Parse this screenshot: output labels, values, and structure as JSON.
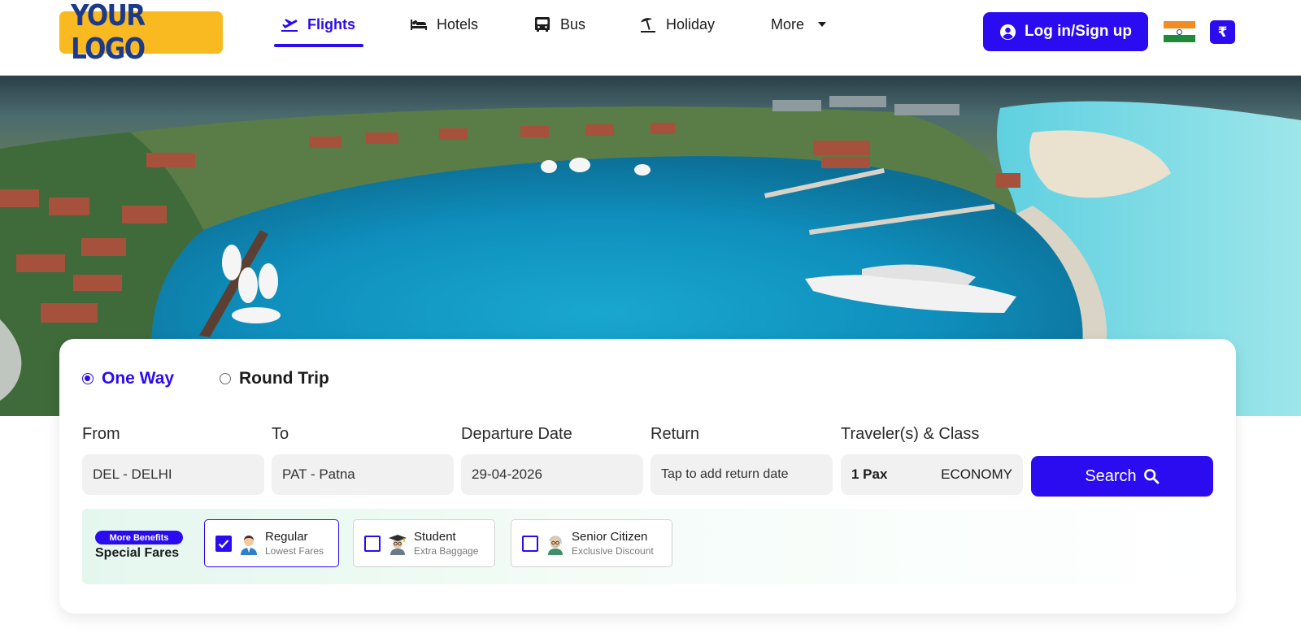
{
  "brand": {
    "logo_text": "YOUR LOGO"
  },
  "nav": {
    "items": [
      {
        "label": "Flights",
        "icon": "plane-departure-icon",
        "active": true
      },
      {
        "label": "Hotels",
        "icon": "bed-icon",
        "active": false
      },
      {
        "label": "Bus",
        "icon": "bus-icon",
        "active": false
      },
      {
        "label": "Holiday",
        "icon": "beach-umbrella-icon",
        "active": false
      },
      {
        "label": "More",
        "icon": "caret-down-icon",
        "active": false
      }
    ]
  },
  "header": {
    "login_label": "Log in/Sign up",
    "currency_symbol": "₹",
    "country_flag": "india-flag-icon"
  },
  "search": {
    "trip_types": [
      {
        "label": "One Way",
        "selected": true
      },
      {
        "label": "Round Trip",
        "selected": false
      }
    ],
    "fields": {
      "from": {
        "label": "From",
        "value": "DEL - DELHI"
      },
      "to": {
        "label": "To",
        "value": "PAT - Patna"
      },
      "departure": {
        "label": "Departure Date",
        "value": "29-04-2026"
      },
      "return": {
        "label": "Return",
        "placeholder": "Tap to add return date"
      },
      "travelers": {
        "label": "Traveler(s) & Class",
        "pax": "1 Pax",
        "cabin_class": "ECONOMY"
      }
    },
    "search_label": "Search"
  },
  "special_fares": {
    "badge": "More Benefits",
    "title": "Special Fares",
    "options": [
      {
        "title": "Regular",
        "subtitle": "Lowest Fares",
        "checked": true
      },
      {
        "title": "Student",
        "subtitle": "Extra Baggage",
        "checked": false
      },
      {
        "title": "Senior Citizen",
        "subtitle": "Exclusive Discount",
        "checked": false
      }
    ]
  },
  "colors": {
    "primary": "#2b0cf0",
    "logo_bg": "#f9b921",
    "logo_text": "#1d3a8a",
    "field_bg": "#f1f1f1",
    "fares_bg": "#e4f7ef"
  }
}
